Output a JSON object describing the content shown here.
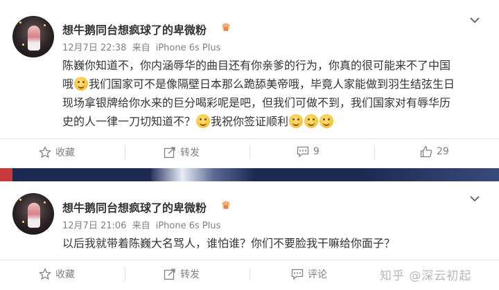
{
  "posts": [
    {
      "username": "想牛鹅同台想疯球了的卑微粉",
      "date": "12月7日 22:38",
      "source_prefix": "来自",
      "device": "iPhone 6s Plus",
      "text_lines": [
        [
          "陈巍你知道不，你内涵辱华的曲目还有你亲爹的行为，你真的很可能来不了中国"
        ],
        [
          "哦",
          "[emoji]",
          "我们国家可不是像隔壁日本那么跪舔美帝哦，毕竟人家能做到羽生结弦生日"
        ],
        [
          "现场拿银牌给你水来的巨分喝彩呢是吧，但我们可做不到，我们国家对有辱华历"
        ],
        [
          "史的人一律一刀切知道不？",
          "[emoji]",
          "我祝你签证顺利",
          "[emoji]",
          "[emoji]",
          "[emoji]"
        ]
      ],
      "actions": {
        "favorite": "收藏",
        "repost": "转发",
        "comments": "9",
        "likes": "29"
      }
    },
    {
      "username": "想牛鹅同台想疯球了的卑微粉",
      "date": "12月7日 21:06",
      "source_prefix": "来自",
      "device": "iPhone 6s Plus",
      "text_lines": [
        [
          "以后我就带着陈巍大名骂人，谁怕谁？你们不要脸我干嘛给你面子？"
        ]
      ],
      "actions": {
        "favorite": "收藏",
        "repost": "转发",
        "comments": "评论"
      }
    }
  ],
  "watermark": "知乎 @深云初起",
  "icons": {
    "emoji": "smile-emoji",
    "badge": "crown-badge-icon",
    "menu": "chevron-down-icon",
    "favorite": "star-icon",
    "repost": "share-arrow-icon",
    "comment": "comment-icon",
    "like": "thumbs-up-icon"
  },
  "colors": {
    "text": "#333333",
    "meta": "#808080",
    "badge": "#e8483a"
  }
}
